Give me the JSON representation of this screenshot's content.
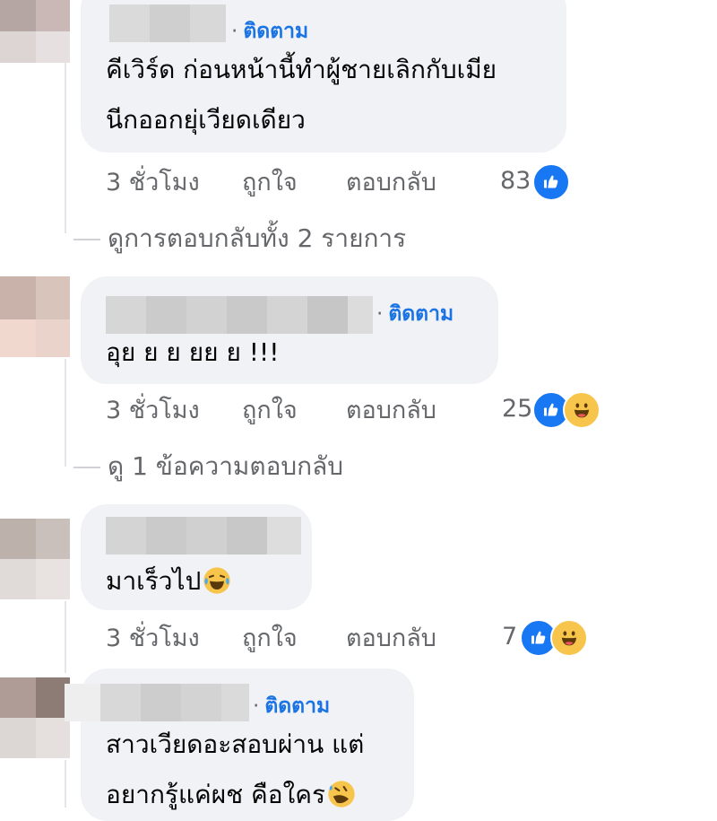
{
  "comments": [
    {
      "follow_label": "ติดตาม",
      "lines": [
        "คีเวิร์ด ก่อนหน้านี้ทำผู้ชายเลิกกับเมีย",
        "นีกออกยุ่เวียดเดียว"
      ],
      "time": "3 ชั่วโมง",
      "like_label": "ถูกใจ",
      "reply_label": "ตอบกลับ",
      "reaction_count": "83",
      "reactions": [
        "like-icon"
      ],
      "view_replies": "ดูการตอบกลับทั้ง 2 รายการ"
    },
    {
      "follow_label": "ติดตาม",
      "lines": [
        "อุย ย ย ยย ย !!!"
      ],
      "time": "3 ชั่วโมง",
      "like_label": "ถูกใจ",
      "reply_label": "ตอบกลับ",
      "reaction_count": "25",
      "reactions": [
        "like-icon",
        "haha-icon"
      ],
      "view_replies": "ดู 1 ข้อความตอบกลับ"
    },
    {
      "lines": [
        "มาเร็วไป"
      ],
      "inline_emoji": "crying-laughing-emoji",
      "time": "3 ชั่วโมง",
      "like_label": "ถูกใจ",
      "reply_label": "ตอบกลับ",
      "reaction_count": "7",
      "reactions": [
        "like-icon",
        "haha-icon"
      ]
    },
    {
      "follow_label": "ติดตาม",
      "lines": [
        "สาวเวียดอะสอบผ่าน แต่",
        "อยากรู้แค่ผช คือใคร"
      ],
      "inline_emoji": "rolling-laughing-emoji"
    }
  ],
  "colors": {
    "follow": "#1b74e4",
    "meta": "#65676b",
    "bubble": "#f0f2f5",
    "like": "#1877f2",
    "haha": "#f7c54b"
  }
}
